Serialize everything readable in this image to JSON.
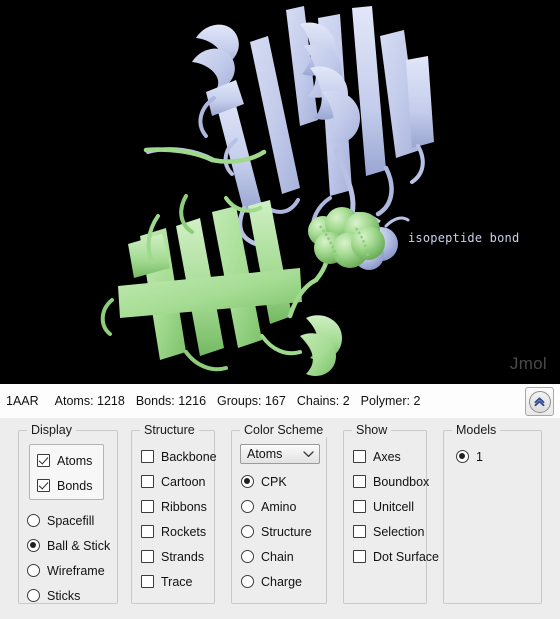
{
  "viewer": {
    "background_color": "#000000",
    "structure_id": "1AAR",
    "annotation_label": "isopeptide bond",
    "watermark": "Jmol",
    "chain_colors": {
      "chain_a": "#c3cbeb",
      "chain_b": "#9fd890"
    }
  },
  "statusbar": {
    "structure_id": "1AAR",
    "atoms": "Atoms: 1218",
    "bonds": "Bonds: 1216",
    "groups": "Groups: 167",
    "chains": "Chains: 2",
    "polymer": "Polymer: 2",
    "collapse_icon": "double-chevron-up-icon"
  },
  "panel": {
    "display": {
      "legend": "Display",
      "checkboxes": [
        {
          "label": "Atoms",
          "checked": true
        },
        {
          "label": "Bonds",
          "checked": true
        }
      ],
      "radios": [
        {
          "label": "Spacefill",
          "checked": false
        },
        {
          "label": "Ball & Stick",
          "checked": true
        },
        {
          "label": "Wireframe",
          "checked": false
        },
        {
          "label": "Sticks",
          "checked": false
        }
      ]
    },
    "structure": {
      "legend": "Structure",
      "checkboxes": [
        {
          "label": "Backbone",
          "checked": false
        },
        {
          "label": "Cartoon",
          "checked": false
        },
        {
          "label": "Ribbons",
          "checked": false
        },
        {
          "label": "Rockets",
          "checked": false
        },
        {
          "label": "Strands",
          "checked": false
        },
        {
          "label": "Trace",
          "checked": false
        }
      ]
    },
    "color_scheme": {
      "legend": "Color Scheme",
      "select": {
        "value": "Atoms",
        "icon": "chevron-down-icon"
      },
      "radios": [
        {
          "label": "CPK",
          "checked": true
        },
        {
          "label": "Amino",
          "checked": false
        },
        {
          "label": "Structure",
          "checked": false
        },
        {
          "label": "Chain",
          "checked": false
        },
        {
          "label": "Charge",
          "checked": false
        }
      ]
    },
    "show": {
      "legend": "Show",
      "checkboxes": [
        {
          "label": "Axes",
          "checked": false
        },
        {
          "label": "Boundbox",
          "checked": false
        },
        {
          "label": "Unitcell",
          "checked": false
        },
        {
          "label": "Selection",
          "checked": false
        },
        {
          "label": "Dot Surface",
          "checked": false
        }
      ]
    },
    "models": {
      "legend": "Models",
      "radios": [
        {
          "label": "1",
          "checked": true
        }
      ]
    }
  }
}
